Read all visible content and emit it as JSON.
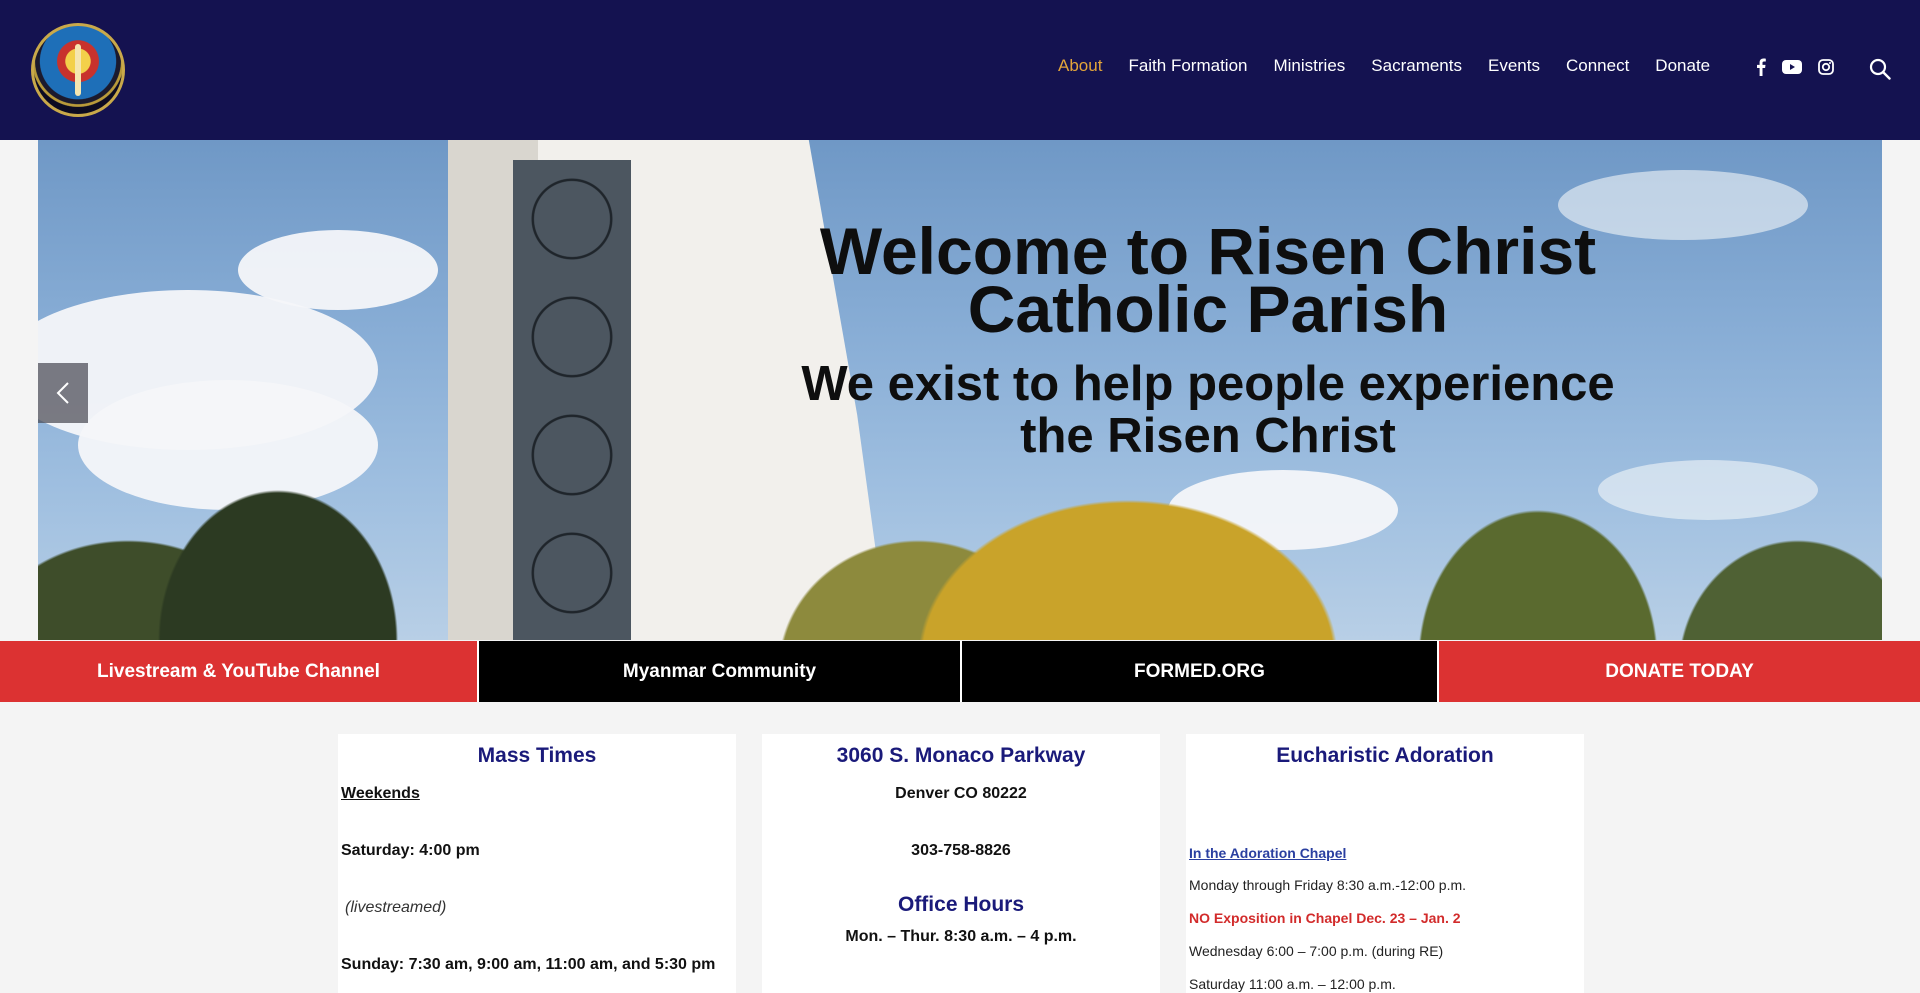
{
  "header": {
    "nav": [
      {
        "label": "About",
        "active": true
      },
      {
        "label": "Faith Formation",
        "active": false
      },
      {
        "label": "Ministries",
        "active": false
      },
      {
        "label": "Sacraments",
        "active": false
      },
      {
        "label": "Events",
        "active": false
      },
      {
        "label": "Connect",
        "active": false
      },
      {
        "label": "Donate",
        "active": false
      }
    ],
    "social_icons": [
      "facebook-icon",
      "youtube-icon",
      "instagram-icon"
    ],
    "search_icon": "search-icon"
  },
  "hero": {
    "title": "Welcome to Risen Christ Catholic Parish",
    "subtitle": "We exist to help people experience the Risen Christ",
    "prev_icon": "chevron-left-icon"
  },
  "buttons": [
    {
      "label": "Livestream & YouTube Channel",
      "color": "#dc3232"
    },
    {
      "label": "Myanmar Community",
      "color": "#000000"
    },
    {
      "label": "FORMED.ORG",
      "color": "#000000"
    },
    {
      "label": "DONATE TODAY",
      "color": "#dc3232"
    }
  ],
  "mass": {
    "title": "Mass Times",
    "weekends": "Weekends",
    "saturday": "Saturday: 4:00 pm",
    "livestreamed": "(livestreamed)",
    "sunday": "Sunday: 7:30 am, 9:00 am, 11:00 am, and 5:30 pm"
  },
  "address": {
    "street": "3060 S. Monaco Parkway",
    "city": "Denver CO 80222",
    "phone": "303-758-8826",
    "office_title": "Office Hours",
    "office_hours": "Mon. – Thur.  8:30 a.m. – 4 p.m."
  },
  "adoration": {
    "title": "Eucharistic Adoration",
    "chapel_link": "In the Adoration Chapel",
    "weekday": "Monday through Friday   8:30 a.m.-12:00 p.m.",
    "notice": "NO Exposition in Chapel Dec. 23 – Jan. 2",
    "wednesday": "Wednesday  6:00 – 7:00 p.m.  (during RE)",
    "saturday": "Saturday  11:00 a.m. – 12:00 p.m."
  }
}
